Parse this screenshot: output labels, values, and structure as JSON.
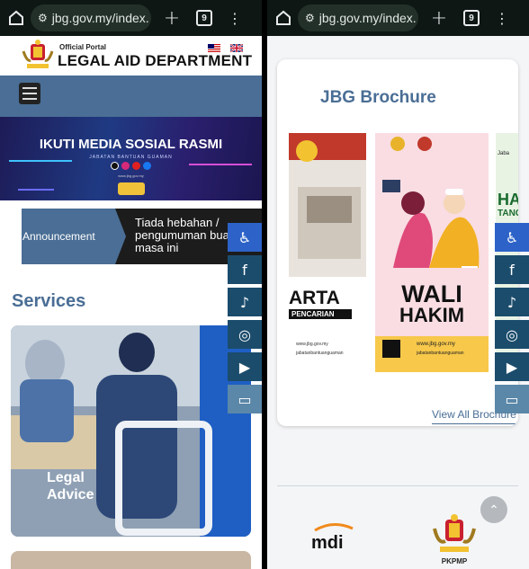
{
  "browser": {
    "url_left": "jbg.gov.my/index.",
    "url_right": "jbg.gov.my/index.",
    "tab_count": "9"
  },
  "header": {
    "official_portal": "Official Portal",
    "department": "LEGAL AID DEPARTMENT"
  },
  "banner": {
    "title": "IKUTI MEDIA SOSIAL RASMI",
    "subtitle": "JABATAN BANTUAN GUAMAN",
    "url": "www.jbg.gov.my"
  },
  "announcement": {
    "label": "Announcement",
    "text_line1": "Tiada hebahan /",
    "text_line2": "pengumuman buat",
    "text_line3": "masa ini"
  },
  "services": {
    "heading": "Services",
    "card_label_line1": "Legal",
    "card_label_line2": "Advice"
  },
  "brochure": {
    "heading": "JBG Brochure",
    "poster1_text1": "ARTA",
    "poster1_text2": "PENCARIAN",
    "poster1_url": "www.jbg.gov.my",
    "poster1_handle": "jabatanbantuanguaman",
    "poster2_line1": "WALI",
    "poster2_line2": "HAKIM",
    "poster2_url": "www.jbg.gov.my",
    "poster2_handle": "jabatanbantuanguaman",
    "poster3_text1": "Jaba",
    "poster3_text2": "HA",
    "poster3_text3": "TANG",
    "view_all": "View All Brochure"
  },
  "footer": {
    "logo1": "mdi",
    "logo2_label": "PKPMP"
  },
  "floating_bar": [
    {
      "icon": "accessibility-icon",
      "glyph": "♿"
    },
    {
      "icon": "facebook-icon",
      "glyph": "f"
    },
    {
      "icon": "tiktok-icon",
      "glyph": "♪"
    },
    {
      "icon": "instagram-icon",
      "glyph": "◎"
    },
    {
      "icon": "youtube-icon",
      "glyph": "▶"
    },
    {
      "icon": "video-icon",
      "glyph": "▭"
    }
  ],
  "colors": {
    "brand_blue": "#4a6e95",
    "access_blue": "#2d63c8",
    "browser_dark": "#0e1713"
  }
}
